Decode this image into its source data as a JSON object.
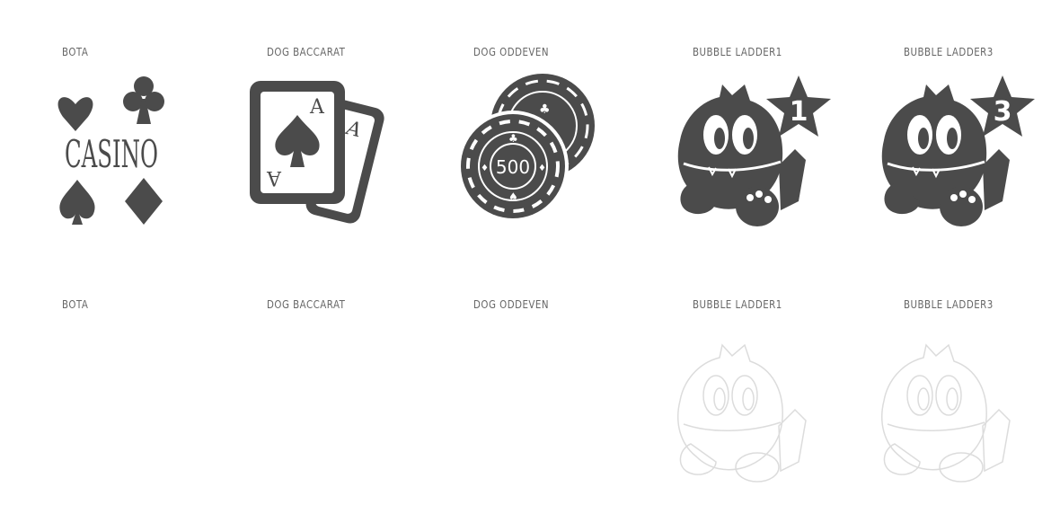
{
  "colors": {
    "icon": "#4b4b4b",
    "ghost": "#d6d6d6",
    "label": "#666666",
    "background": "#ffffff"
  },
  "games_top": [
    {
      "label": "BOTA",
      "icon": "casino-suits-icon",
      "word": "CASINO"
    },
    {
      "label": "DOG BACCARAT",
      "icon": "ace-cards-icon",
      "card_rank": "A"
    },
    {
      "label": "DOG ODDEVEN",
      "icon": "poker-chips-icon",
      "chip_value": "500"
    },
    {
      "label": "BUBBLE LADDER1",
      "icon": "bubble-dragon-1-icon",
      "badge": "1"
    },
    {
      "label": "BUBBLE LADDER3",
      "icon": "bubble-dragon-3-icon",
      "badge": "3"
    }
  ],
  "games_bottom": [
    {
      "label": "BOTA"
    },
    {
      "label": "DOG BACCARAT"
    },
    {
      "label": "DOG ODDEVEN"
    },
    {
      "label": "BUBBLE LADDER1",
      "icon": "bubble-dragon-ghost-icon"
    },
    {
      "label": "BUBBLE LADDER3",
      "icon": "bubble-dragon-ghost-icon"
    }
  ]
}
